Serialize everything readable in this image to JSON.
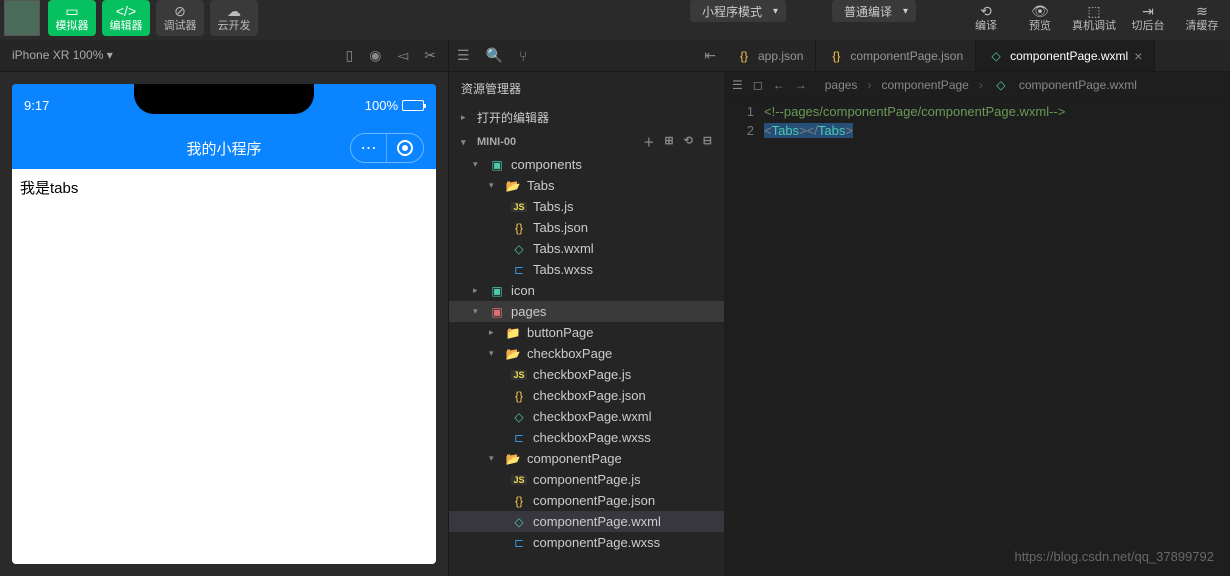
{
  "toolbar": {
    "buttons": [
      {
        "icon": "▭",
        "label": "模拟器",
        "style": "green"
      },
      {
        "icon": "</>",
        "label": "编辑器",
        "style": "green"
      },
      {
        "icon": "⊕",
        "label": "调试器",
        "style": "dark"
      },
      {
        "icon": "☁",
        "label": "云开发",
        "style": "dark"
      }
    ],
    "mode_dropdown": "小程序模式",
    "compile_dropdown": "普通编译",
    "right_buttons": [
      {
        "icon": "⟲",
        "label": "编译"
      },
      {
        "icon": "👁",
        "label": "预览"
      },
      {
        "icon": "⬚",
        "label": "真机调试"
      },
      {
        "icon": "⇥",
        "label": "切后台"
      },
      {
        "icon": "≋",
        "label": "清缓存"
      }
    ]
  },
  "simulator": {
    "device": "iPhone XR 100%",
    "status_time": "9:17",
    "battery_pct": "100%",
    "app_title": "我的小程序",
    "content_text": "我是tabs"
  },
  "explorer": {
    "title": "资源管理器",
    "open_editors": "打开的编辑器",
    "project_name": "MINI-00",
    "tree": {
      "components": "components",
      "tabs_folder": "Tabs",
      "tabs_files": [
        "Tabs.js",
        "Tabs.json",
        "Tabs.wxml",
        "Tabs.wxss"
      ],
      "icon_folder": "icon",
      "pages_folder": "pages",
      "buttonPage": "buttonPage",
      "checkboxPage": "checkboxPage",
      "checkbox_files": [
        "checkboxPage.js",
        "checkboxPage.json",
        "checkboxPage.wxml",
        "checkboxPage.wxss"
      ],
      "componentPage": "componentPage",
      "component_files": [
        "componentPage.js",
        "componentPage.json",
        "componentPage.wxml",
        "componentPage.wxss"
      ]
    }
  },
  "editor": {
    "tabs": [
      {
        "icon": "{}",
        "label": "app.json",
        "active": false
      },
      {
        "icon": "{}",
        "label": "componentPage.json",
        "active": false
      },
      {
        "icon": "◇",
        "label": "componentPage.wxml",
        "active": true
      }
    ],
    "breadcrumb": [
      "pages",
      "componentPage",
      "componentPage.wxml"
    ],
    "lines": {
      "1": "<!--pages/componentPage/componentPage.wxml-->",
      "2_open": "<Tabs>",
      "2_close": "</Tabs>"
    }
  },
  "watermark": "https://blog.csdn.net/qq_37899792"
}
